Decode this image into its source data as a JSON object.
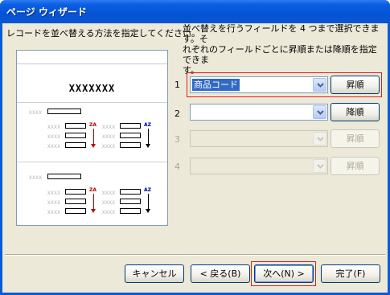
{
  "window": {
    "title": "ページ ウィザード"
  },
  "instruction": "レコードを並べ替える方法を指定してください。",
  "description": [
    "並べ替えを行うフィールドを 4 つまで選択できます。そ",
    "れぞれのフィールドごとに昇順または降順を指定できま",
    "す。"
  ],
  "preview": {
    "heading": "XXXXXXX",
    "placeholder": "XXXX",
    "za_label": "ZA",
    "az_label": "AZ"
  },
  "sort_rows": [
    {
      "number": "1",
      "value": "商品コード",
      "order": "昇順",
      "enabled": true
    },
    {
      "number": "2",
      "value": "",
      "order": "降順",
      "enabled": true
    },
    {
      "number": "3",
      "value": "",
      "order": "昇順",
      "enabled": false
    },
    {
      "number": "4",
      "value": "",
      "order": "昇順",
      "enabled": false
    }
  ],
  "buttons": {
    "cancel": "キャンセル",
    "back": "< 戻る(B)",
    "next": "次へ(N) >",
    "finish": "完了(F)"
  },
  "colors": {
    "titlebar": "#0553d6",
    "dialog_bg": "#ece9d8",
    "highlight": "#e51a1a",
    "selection": "#316ac5"
  }
}
